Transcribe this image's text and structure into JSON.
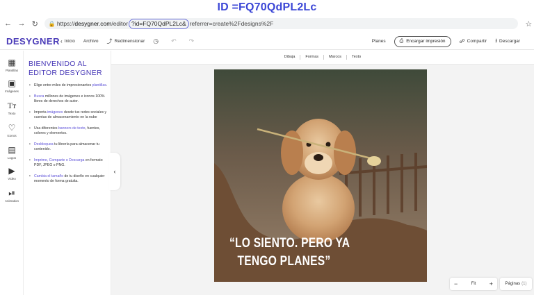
{
  "caption": {
    "text": "ID =FQ70QdPL2Lc"
  },
  "browser": {
    "url_prefix": "https://",
    "url_domain": "desygner.com",
    "url_path": "/editor",
    "url_highlight": "?id=FQ70QdPL2Lc&",
    "url_rest": "referrer=create%2Fdesigns%2F"
  },
  "header": {
    "logo": "DESYGNER",
    "inicio": "Inicio",
    "archivo": "Archivo",
    "redimensionar": "Redimensionar",
    "planes": "Planes",
    "encargar": "Encargar impresión",
    "compartir": "Compartir",
    "descargar": "Descargar"
  },
  "sidebar": {
    "items": [
      {
        "label": "Plantillas",
        "icon": "templates-icon"
      },
      {
        "label": "Imágenes",
        "icon": "images-icon"
      },
      {
        "label": "Texto",
        "icon": "text-icon"
      },
      {
        "label": "Iconos",
        "icon": "heart-icon"
      },
      {
        "label": "Logos",
        "icon": "briefcase-icon"
      },
      {
        "label": "Video",
        "icon": "video-icon"
      },
      {
        "label": "Animation",
        "icon": "play-icon"
      }
    ]
  },
  "panel": {
    "title": "BIENVENIDO AL EDITOR DESYGNER",
    "bullets": [
      {
        "pre": "Elige entre miles de impresionantes ",
        "link": "plantillas",
        "post": "."
      },
      {
        "pre": "",
        "link": "Busca",
        "post": " millones de imágenes e iconos 100% libres de derechos de autor."
      },
      {
        "pre": "Importa ",
        "link": "imágenes",
        "post": " desde tus redes sociales y cuentas de almacenamiento en la nube"
      },
      {
        "pre": "Usa diferentes ",
        "link": "banners de texto",
        "post": ", fuentes, colores y elementos."
      },
      {
        "pre": "",
        "link": "Desbloquea",
        "post": " tu librería para almacenar tu contenido."
      },
      {
        "pre": "",
        "link": "Imprime, Comparte o Descarga",
        "post": " en formato PDF, JPEG o PNG."
      },
      {
        "pre": "",
        "link": "Cambia el tamaño",
        "post": " de tu diseño en cualquier momento de forma gratuita."
      }
    ]
  },
  "canvas": {
    "tabs": [
      "Dibuja",
      "Formas",
      "Marcos",
      "Texto"
    ],
    "quote_line1": "“LO SIENTO. PERO YA",
    "quote_line2": "TENGO PLANES”"
  },
  "zoom": {
    "minus": "−",
    "label": "Fit",
    "plus": "+"
  },
  "pages": {
    "label": "Páginas",
    "count": "(1)"
  },
  "colors": {
    "brand": "#4a3bb8",
    "poster_brown": "#6e4e35",
    "caption": "#3b46d6"
  }
}
